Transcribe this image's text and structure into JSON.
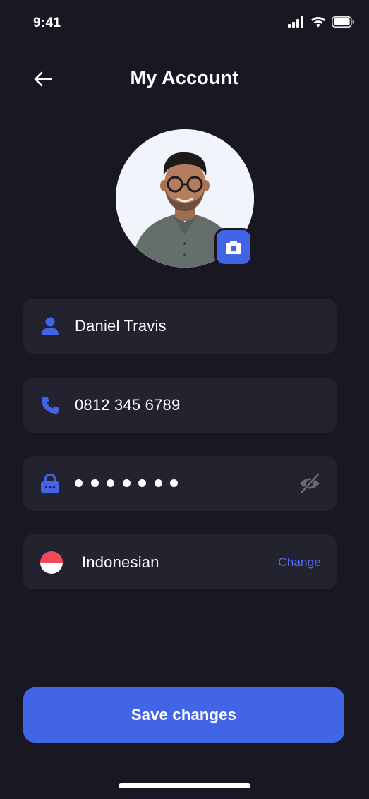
{
  "status_bar": {
    "time": "9:41"
  },
  "header": {
    "title": "My Account",
    "back_icon": "arrow-left-icon"
  },
  "profile": {
    "camera_icon": "camera-icon"
  },
  "fields": {
    "name": {
      "icon": "user-icon",
      "value": "Daniel Travis"
    },
    "phone": {
      "icon": "phone-icon",
      "value": "0812 345 6789"
    },
    "password": {
      "icon": "lock-icon",
      "masked_length": 7,
      "toggle_icon": "eye-off-icon"
    },
    "language": {
      "flag": "indonesia-flag",
      "value": "Indonesian",
      "change_label": "Change"
    }
  },
  "save_button": {
    "label": "Save changes"
  },
  "colors": {
    "background": "#181722",
    "field_background": "#23222f",
    "accent": "#4264e7",
    "link": "#4f6ef0",
    "muted_icon": "#6b6a77"
  }
}
